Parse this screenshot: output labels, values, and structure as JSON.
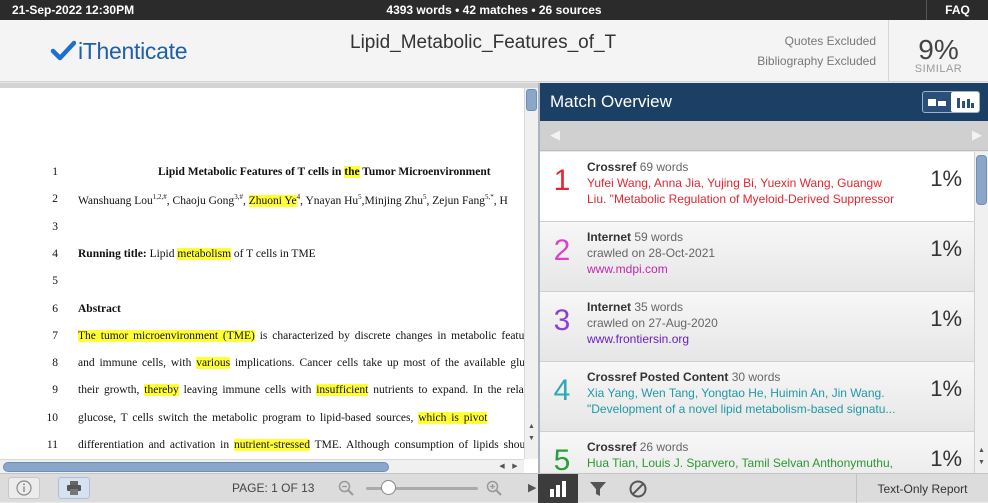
{
  "topbar": {
    "date": "21-Sep-2022 12:30PM",
    "stats": "4393 words • 42 matches • 26 sources",
    "faq": "FAQ"
  },
  "header": {
    "logo_text": "iThenticate",
    "doc_title": "Lipid_Metabolic_Features_of_T",
    "quotes": "Quotes Excluded",
    "bibliography": "Bibliography Excluded",
    "similarity_pct": "9%",
    "similarity_label": "SIMILAR"
  },
  "document": {
    "lines": [
      {
        "num": "1",
        "segments": [
          {
            "t": "Lipid Metabolic Features of T cells in "
          },
          {
            "t": "the",
            "h": true
          },
          {
            "t": " Tumor Microenvironment"
          }
        ]
      },
      {
        "num": "2",
        "segments": [
          {
            "t": "Wanshuang Lou"
          },
          {
            "t": "1,2,#",
            "sup": true
          },
          {
            "t": ", Chaoju Gong"
          },
          {
            "t": "3,#",
            "sup": true
          },
          {
            "t": ", "
          },
          {
            "t": "Zhuoni Ye",
            "h": true
          },
          {
            "t": "4",
            "sup": true
          },
          {
            "t": ", Ynayan Hu"
          },
          {
            "t": "5",
            "sup": true
          },
          {
            "t": ",Minjing Zhu"
          },
          {
            "t": "5",
            "sup": true
          },
          {
            "t": ", Zejun Fang"
          },
          {
            "t": "5,*",
            "sup": true
          },
          {
            "t": ", H"
          }
        ]
      },
      {
        "num": "3",
        "segments": []
      },
      {
        "num": "4",
        "segments": [
          {
            "t": "Running title:",
            "b": true
          },
          {
            "t": " Lipid "
          },
          {
            "t": "metabolism",
            "h": true
          },
          {
            "t": " of T cells in TME"
          }
        ]
      },
      {
        "num": "5",
        "segments": []
      },
      {
        "num": "6",
        "segments": [
          {
            "t": "Abstract",
            "b": true
          }
        ]
      },
      {
        "num": "7",
        "segments": [
          {
            "t": "The tumor microenvironment (TME)",
            "h": true
          },
          {
            "t": " is characterized by discrete changes in metabolic featu"
          }
        ]
      },
      {
        "num": "8",
        "segments": [
          {
            "t": "and immune cells, with "
          },
          {
            "t": "various",
            "h": true
          },
          {
            "t": " implications. Cancer cells take up most of the available gluco"
          }
        ]
      },
      {
        "num": "9",
        "segments": [
          {
            "t": "their growth, "
          },
          {
            "t": "thereby",
            "h": true
          },
          {
            "t": " leaving immune cells with "
          },
          {
            "t": "insufficient",
            "h": true
          },
          {
            "t": " nutrients to expand. In the relativ"
          }
        ]
      },
      {
        "num": "10",
        "segments": [
          {
            "t": "glucose, T cells switch the metabolic program to lipid-based sources, "
          },
          {
            "t": "which is pivot",
            "h": true
          }
        ]
      },
      {
        "num": "11",
        "segments": [
          {
            "t": "differentiation and activation in "
          },
          {
            "t": "nutrient-stressed",
            "h": true
          },
          {
            "t": " TME. Although consumption of lipids shoul"
          }
        ]
      }
    ]
  },
  "match_panel": {
    "title": "Match Overview",
    "matches": [
      {
        "rank": "1",
        "rank_color": "#e3262f",
        "source": "Crossref",
        "words": "69 words",
        "line2": "Yufei Wang, Anna Jia, Yujing Bi, Yuexin Wang, Guangw",
        "line2_color": "#e3262f",
        "line3": "Liu. \"Metabolic Regulation of Myeloid-Derived Suppressor",
        "line3_color": "#e3262f",
        "pct": "1%"
      },
      {
        "rank": "2",
        "rank_color": "#e040c8",
        "source": "Internet",
        "words": "59 words",
        "line2": "crawled on 28-Oct-2021",
        "line2_color": "#666666",
        "line3": "www.mdpi.com",
        "line3_color": "#c426b0",
        "pct": "1%"
      },
      {
        "rank": "3",
        "rank_color": "#8a40d8",
        "source": "Internet",
        "words": "35 words",
        "line2": "crawled on 27-Aug-2020",
        "line2_color": "#666666",
        "line3": "www.frontiersin.org",
        "line3_color": "#6a22c0",
        "pct": "1%"
      },
      {
        "rank": "4",
        "rank_color": "#2ea8b4",
        "source": "Crossref Posted Content",
        "words": "30 words",
        "line2": "Xia Yang, Wen Tang, Yongtao He, Huimin An, Jin Wang.",
        "line2_color": "#2098a6",
        "line3": "\"Development of a novel lipid metabolism-based signatu...",
        "line3_color": "#2098a6",
        "pct": "1%"
      },
      {
        "rank": "5",
        "rank_color": "#2aa038",
        "source": "Crossref",
        "words": "26 words",
        "line2": "Hua Tian, Louis J. Sparvero, Tamil Selvan Anthonymuthu,",
        "line2_color": "#2a9a30",
        "line3": "",
        "line3_color": "#2a9a30",
        "pct": "1%"
      }
    ]
  },
  "bottombar": {
    "page_indicator": "PAGE: 1 OF 13",
    "zoom_level": 0.2,
    "text_only": "Text-Only Report"
  }
}
